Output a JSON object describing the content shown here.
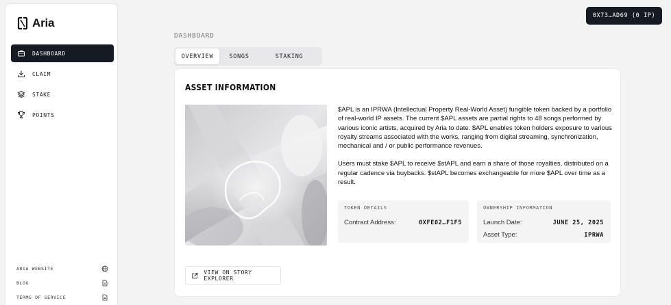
{
  "app": {
    "name": "Aria"
  },
  "wallet": {
    "label": "0X73…AD69 (0 IP)"
  },
  "sidebar": {
    "items": [
      {
        "label": "DASHBOARD",
        "icon": "briefcase-icon",
        "active": true
      },
      {
        "label": "CLAIM",
        "icon": "download-icon",
        "active": false
      },
      {
        "label": "STAKE",
        "icon": "layers-icon",
        "active": false
      },
      {
        "label": "POINTS",
        "icon": "trophy-icon",
        "active": false
      }
    ],
    "footer": [
      {
        "label": "ARIA WEBSITE",
        "icon": "globe-icon"
      },
      {
        "label": "BLOG",
        "icon": "document-icon"
      },
      {
        "label": "TERMS OF SERVICE",
        "icon": "document-icon"
      }
    ]
  },
  "main": {
    "page_title": "DASHBOARD",
    "tabs": [
      {
        "label": "OVERVIEW",
        "active": true
      },
      {
        "label": "SONGS",
        "active": false
      },
      {
        "label": "STAKING",
        "active": false
      }
    ],
    "card": {
      "title": "ASSET INFORMATION",
      "paragraph1": "$APL is an IPRWA (Intellectual Property Real-World Asset) fungible token backed by a portfolio of real-world IP assets. The current $APL assets are partial rights to 48 songs performed by various iconic artists, acquired by Aria to date. $APL enables token holders exposure to various royalty streams associated with the works, ranging from digital streaming, synchronization, mechanical and / or public performance revenues.",
      "paragraph2": "Users must stake $APL to receive $stAPL and earn a share of those royalties, distributed on a regular cadence via buybacks. $stAPL becomes exchangeable for more $APL over time as a result.",
      "token_details": {
        "heading": "TOKEN DETAILS",
        "contract_label": "Contract Address:",
        "contract_value": "0XFE02…F1F5"
      },
      "ownership": {
        "heading": "OWNERSHIP INFORMATION",
        "launch_label": "Launch Date:",
        "launch_value": "JUNE 25, 2025",
        "type_label": "Asset Type:",
        "type_value": "IPRWA"
      },
      "explorer_button": "VIEW ON STORY EXPLORER"
    }
  },
  "colors": {
    "dark": "#161a22",
    "background": "#f3f3f4",
    "card": "#ffffff"
  }
}
